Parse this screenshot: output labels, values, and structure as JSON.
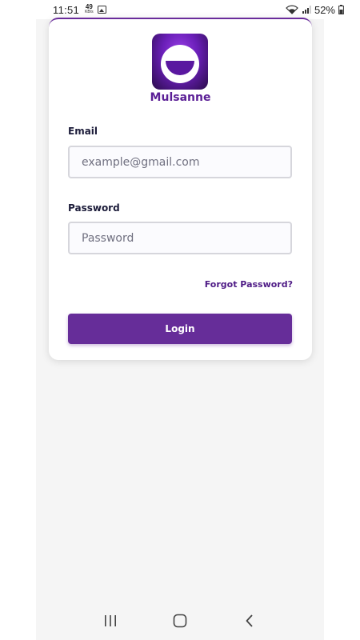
{
  "status_bar": {
    "time": "11:51",
    "net_speed": "49",
    "net_speed_unit": "KB/s",
    "battery": "52%",
    "icons": [
      "image-notification-icon",
      "wifi-icon",
      "signal-icon",
      "battery-icon"
    ]
  },
  "app": {
    "brand_name": "Mulsanne",
    "logo_icon": "smiley-logo-icon",
    "accent_color": "#662d99"
  },
  "form": {
    "email_label": "Email",
    "email_placeholder": "example@gmail.com",
    "email_value": "",
    "password_label": "Password",
    "password_placeholder": "Password",
    "password_value": "",
    "forgot_password": "Forgot Password?",
    "login_label": "Login"
  },
  "nav_bar": {
    "icons": [
      "recent-apps-icon",
      "home-icon",
      "back-icon"
    ]
  }
}
